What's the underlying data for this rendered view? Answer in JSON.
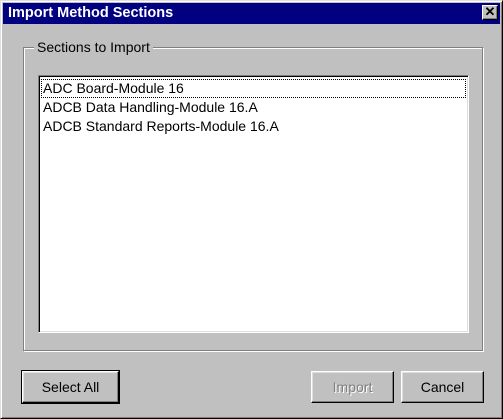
{
  "window": {
    "title": "Import Method Sections",
    "close_glyph": "✕"
  },
  "group": {
    "legend": "Sections to Import"
  },
  "list": {
    "items": [
      "ADC Board-Module 16",
      "ADCB Data Handling-Module 16.A",
      "ADCB Standard Reports-Module 16.A"
    ]
  },
  "buttons": {
    "select_all": "Select All",
    "import": "Import",
    "cancel": "Cancel"
  },
  "colors": {
    "titlebar": "#000080",
    "face": "#c0c0c0"
  }
}
